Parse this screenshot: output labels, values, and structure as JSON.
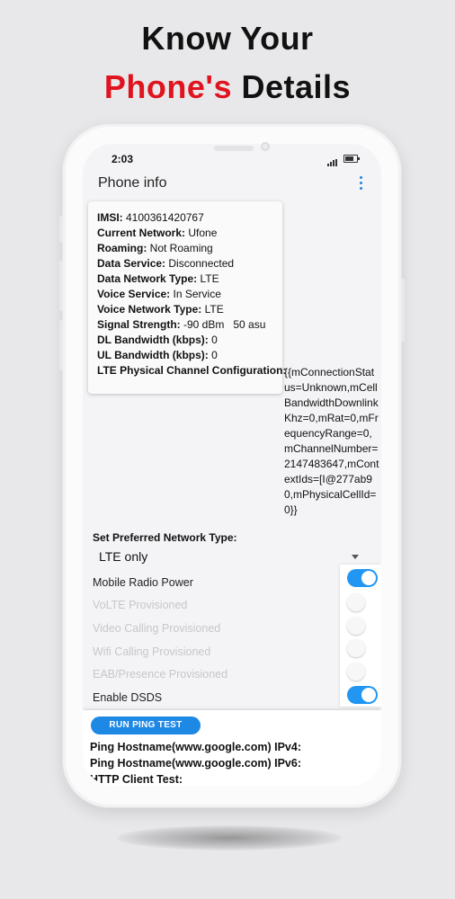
{
  "headline": {
    "line1": "Know Your",
    "line2_accent": "Phone's",
    "line2_rest": " Details",
    "accent_color": "#e0141e"
  },
  "status_bar": {
    "time": "2:03",
    "icons": [
      "signal-icon",
      "battery-icon"
    ]
  },
  "app_bar": {
    "title": "Phone info",
    "menu_icon": "more-vertical-icon"
  },
  "info": [
    {
      "label": "IMSI:",
      "value": " 4100361420767"
    },
    {
      "label": "Current Network:",
      "value": " Ufone"
    },
    {
      "label": "Roaming:",
      "value": " Not Roaming"
    },
    {
      "label": "Data Service:",
      "value": " Disconnected"
    },
    {
      "label": "Data Network Type:",
      "value": " LTE"
    },
    {
      "label": "Voice Service:",
      "value": " In Service"
    },
    {
      "label": "Voice Network Type:",
      "value": " LTE"
    },
    {
      "label": "Signal Strength:",
      "value": " -90 dBm   50 asu"
    },
    {
      "label": "DL Bandwidth (kbps):",
      "value": " 0"
    },
    {
      "label": "UL Bandwidth (kbps):",
      "value": " 0"
    },
    {
      "label": "LTE Physical Channel Configuration:",
      "value": ""
    }
  ],
  "lte_config_value": "{{mConnectionStatus=Unknown,mCellBandwidthDownlinkKhz=0,mRat=0,mFrequencyRange=0,mChannelNumber=2147483647,mContextIds=[I@277ab90,mPhysicalCellId=0}}",
  "preferred_network": {
    "label": "Set Preferred Network Type:",
    "value": "LTE only"
  },
  "toggles": [
    {
      "label": "Mobile Radio Power",
      "on": true
    },
    {
      "label": "VoLTE Provisioned",
      "on": false
    },
    {
      "label": "Video Calling Provisioned",
      "on": false
    },
    {
      "label": "Wifi Calling Provisioned",
      "on": false
    },
    {
      "label": "EAB/Presence Provisioned",
      "on": false
    },
    {
      "label": "Enable DSDS",
      "on": true
    }
  ],
  "ping": {
    "button_label": "RUN PING TEST",
    "ipv4_label": "Ping Hostname(www.google.com) IPv4:",
    "ipv6_label": "Ping Hostname(www.google.com) IPv6:",
    "http_label": "HTTP Client Test:"
  },
  "colors": {
    "accent_blue": "#2196f3",
    "button_blue": "#1e88e5"
  }
}
